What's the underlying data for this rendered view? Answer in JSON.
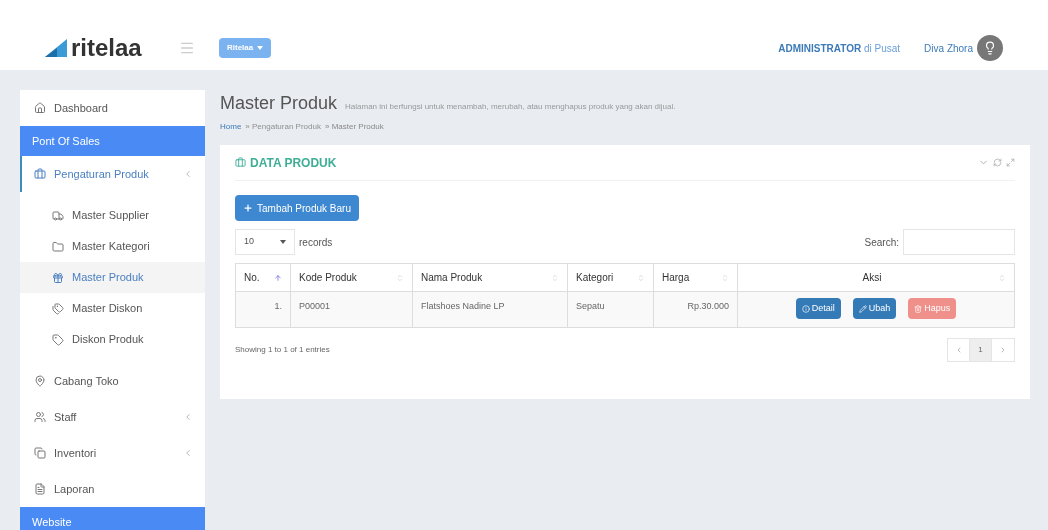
{
  "header": {
    "logo": "ritelaa",
    "badge": "Ritelaa",
    "role": "ADMINISTRATOR",
    "role_sep": "di",
    "location": "Pusat",
    "user": "Diva Zhora"
  },
  "sidebar": {
    "items": [
      {
        "kind": "link",
        "label": "Dashboard",
        "selected": false
      },
      {
        "kind": "section",
        "label": "Pont Of Sales"
      },
      {
        "kind": "link",
        "label": "Pengaturan Produk",
        "expanded": true,
        "children": [
          {
            "kind": "link",
            "label": "Master Supplier",
            "selected": false
          },
          {
            "kind": "link",
            "label": "Master Kategori",
            "selected": false
          },
          {
            "kind": "link",
            "label": "Master Produk",
            "selected": true
          },
          {
            "kind": "link",
            "label": "Master Diskon",
            "selected": false
          },
          {
            "kind": "link",
            "label": "Diskon Produk",
            "selected": false
          }
        ]
      },
      {
        "kind": "link",
        "label": "Cabang Toko",
        "selected": false
      },
      {
        "kind": "link",
        "label": "Staff",
        "selected": false,
        "expanded": false
      },
      {
        "kind": "link",
        "label": "Inventori",
        "selected": false,
        "expanded": false
      },
      {
        "kind": "link",
        "label": "Laporan",
        "selected": false
      },
      {
        "kind": "section",
        "label": "Website"
      }
    ]
  },
  "page": {
    "title": "Master Produk",
    "subtitle": "Halaman ini berfungsi untuk menambah, merubah, atau menghapus produk yang akan dijual.",
    "breadcrumb": [
      {
        "label": "Home",
        "kind": "link"
      },
      {
        "label": "» Pengaturan Produk",
        "kind": "muted"
      },
      {
        "label": "» Master Produk",
        "kind": "current"
      }
    ]
  },
  "card": {
    "title": "DATA PRODUK",
    "add_button": "Tambah Produk Baru",
    "page_size": "10",
    "page_size_label": "records",
    "search_label": "Search:",
    "table": {
      "columns": [
        {
          "label": "No.",
          "sorted": true
        },
        {
          "label": "Kode Produk",
          "sorted": false
        },
        {
          "label": "Nama Produk",
          "sorted": false
        },
        {
          "label": "Kategori",
          "sorted": false
        },
        {
          "label": "Harga",
          "sorted": false
        },
        {
          "label": "Aksi",
          "sorted": false
        }
      ],
      "rows": [
        {
          "no": "1.",
          "code": "P00001",
          "name": "Flatshoes Nadine LP",
          "category": "Sepatu",
          "price": "Rp.30.000",
          "actions": [
            {
              "kind": "detail",
              "label": "Detail"
            },
            {
              "kind": "edit",
              "label": "Ubah"
            },
            {
              "kind": "delete",
              "label": "Hapus"
            }
          ]
        }
      ]
    },
    "info": "Showing 1 to 1 of 1 entries",
    "pages": [
      {
        "label": "1",
        "selected": true
      }
    ]
  }
}
